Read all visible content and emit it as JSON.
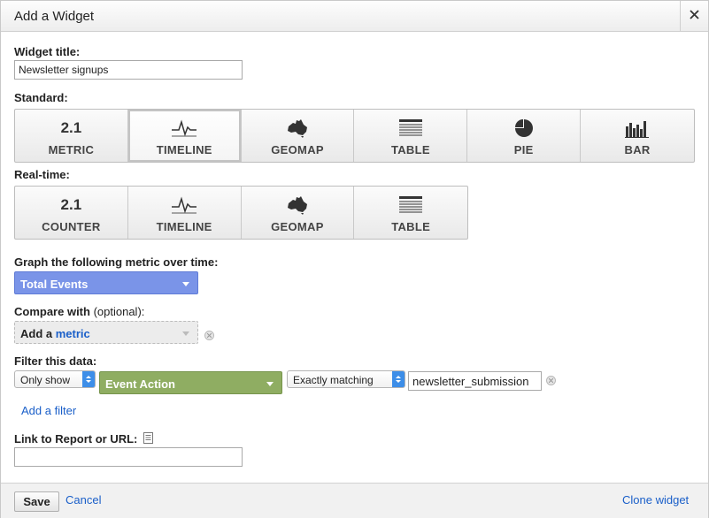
{
  "dialog": {
    "title": "Add a Widget",
    "close_symbol": "✕"
  },
  "widget_title": {
    "label": "Widget title:",
    "value": "Newsletter signups"
  },
  "standard": {
    "label": "Standard:",
    "selected": "TIMELINE",
    "buttons": [
      {
        "caption": "METRIC",
        "icon": "metric-number-icon",
        "icon_text": "2.1"
      },
      {
        "caption": "TIMELINE",
        "icon": "timeline-icon"
      },
      {
        "caption": "GEOMAP",
        "icon": "geomap-australia-icon"
      },
      {
        "caption": "TABLE",
        "icon": "table-icon"
      },
      {
        "caption": "PIE",
        "icon": "pie-chart-icon"
      },
      {
        "caption": "BAR",
        "icon": "bar-chart-icon"
      }
    ]
  },
  "realtime": {
    "label": "Real-time:",
    "buttons": [
      {
        "caption": "COUNTER",
        "icon": "counter-number-icon",
        "icon_text": "2.1"
      },
      {
        "caption": "TIMELINE",
        "icon": "timeline-icon"
      },
      {
        "caption": "GEOMAP",
        "icon": "geomap-australia-icon"
      },
      {
        "caption": "TABLE",
        "icon": "table-icon"
      }
    ]
  },
  "graph": {
    "label": "Graph the following metric over time:",
    "metric": "Total Events"
  },
  "compare": {
    "label": "Compare with",
    "label_optional": " (optional):",
    "add_text": "Add a ",
    "add_link": "metric"
  },
  "filter": {
    "label": "Filter this data:",
    "mode": "Only show",
    "dimension": "Event Action",
    "match_type": "Exactly matching",
    "value": "newsletter_submission",
    "add_filter": "Add a filter"
  },
  "link": {
    "label": "Link to Report or URL:",
    "value": ""
  },
  "footer": {
    "save": "Save",
    "cancel": "Cancel",
    "clone": "Clone widget"
  },
  "colors": {
    "metric_dropdown": "#7a94e8",
    "dimension_dropdown": "#8fad62",
    "link": "#1a5fc9",
    "select_spinner": "#3d8ee8"
  }
}
